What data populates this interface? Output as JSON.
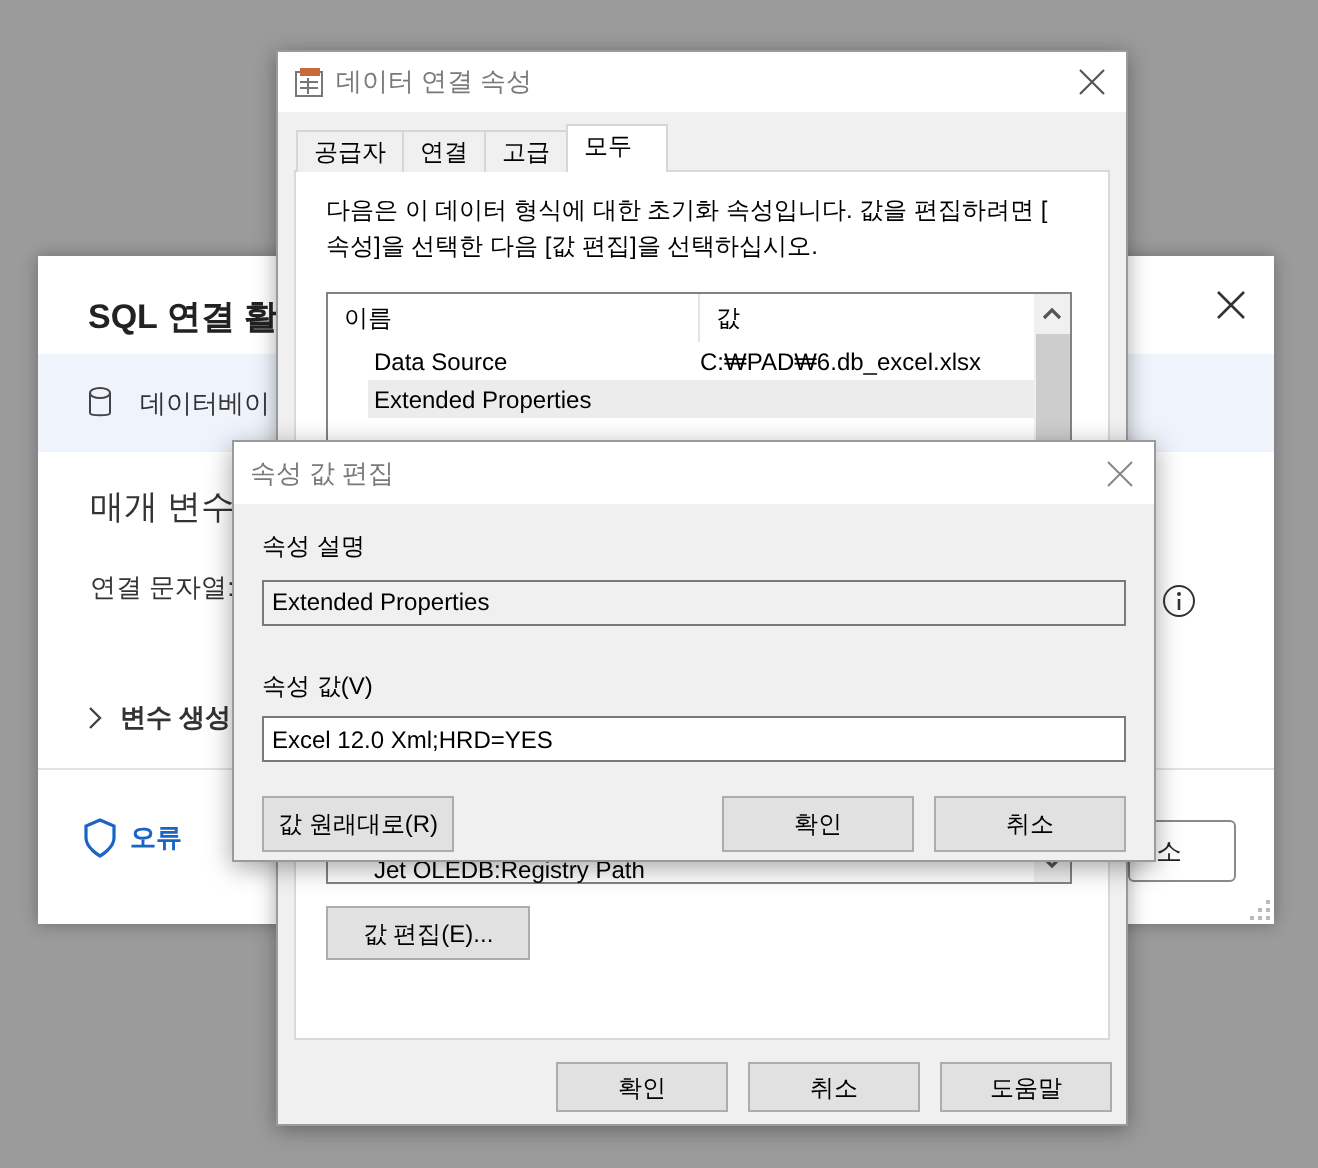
{
  "background_dialog": {
    "title": "SQL 연결 활",
    "db_label": "데이터베이",
    "section_title": "매개 변수",
    "field_label": "연결 문자열:",
    "expander": {
      "label": "변수 생성",
      "expanded": false
    },
    "status": "오류",
    "cut_button": "소"
  },
  "data_link": {
    "title": "데이터 연결 속성",
    "tabs": [
      {
        "label": "공급자",
        "selected": false
      },
      {
        "label": "연결",
        "selected": false
      },
      {
        "label": "고급",
        "selected": false
      },
      {
        "label": "모두",
        "selected": true
      }
    ],
    "description_lines": [
      "다음은 이 데이터 형식에 대한 초기화 속성입니다. 값을 편집하려면 [",
      "속성]을 선택한 다음 [값 편집]을 선택하십시오."
    ],
    "columns": [
      "이름",
      "값"
    ],
    "rows": [
      {
        "name": "Data Source",
        "value": "C:₩PAD₩6.db_excel.xlsx",
        "selected": false
      },
      {
        "name": "Extended Properties",
        "selected": true
      }
    ],
    "bottom_row": {
      "name": "Jet OLEDB:Registry Path"
    },
    "edit_button": "값 편집(E)...",
    "buttons": [
      "확인",
      "취소",
      "도움말"
    ]
  },
  "edit_dialog": {
    "title": "속성 값 편집",
    "description_label": "속성 설명",
    "description_value": "Extended Properties",
    "value_label": "속성 값(V)",
    "value": "Excel 12.0 Xml;HRD=YES",
    "reset_button": "값 원래대로(R)",
    "buttons": [
      "확인",
      "취소"
    ]
  }
}
